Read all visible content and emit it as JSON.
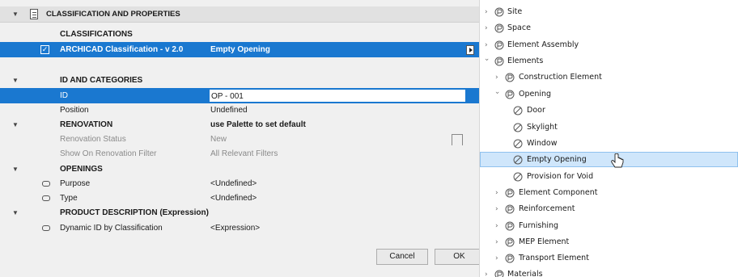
{
  "panel": {
    "title": "CLASSIFICATION AND PROPERTIES",
    "classifications_heading": "CLASSIFICATIONS",
    "classification": {
      "system": "ARCHICAD Classification - v 2.0",
      "value": "Empty Opening"
    },
    "sections": {
      "id_categories": "ID AND CATEGORIES",
      "renovation": "RENOVATION",
      "renovation_value": "use Palette to set default",
      "openings": "OPENINGS",
      "product": "PRODUCT DESCRIPTION (Expression)"
    },
    "rows": {
      "id": {
        "label": "ID",
        "value": "OP - 001"
      },
      "position": {
        "label": "Position",
        "value": "Undefined"
      },
      "renovation_status": {
        "label": "Renovation Status",
        "value": "New"
      },
      "show_filter": {
        "label": "Show On Renovation Filter",
        "value": "All Relevant Filters"
      },
      "purpose": {
        "label": "Purpose",
        "value": "<Undefined>"
      },
      "type": {
        "label": "Type",
        "value": "<Undefined>"
      },
      "dynamic_id": {
        "label": "Dynamic ID by Classification",
        "value": "<Expression>"
      }
    },
    "buttons": {
      "cancel": "Cancel",
      "ok": "OK"
    }
  },
  "tree": {
    "items": [
      {
        "label": "Site",
        "expanded": false
      },
      {
        "label": "Space",
        "expanded": false
      },
      {
        "label": "Element Assembly",
        "expanded": false
      },
      {
        "label": "Elements",
        "expanded": true
      },
      {
        "label": "Construction Element",
        "expanded": false
      },
      {
        "label": "Opening",
        "expanded": true
      },
      {
        "label": "Door"
      },
      {
        "label": "Skylight"
      },
      {
        "label": "Window"
      },
      {
        "label": "Empty Opening",
        "selected": true
      },
      {
        "label": "Provision for Void"
      },
      {
        "label": "Element Component",
        "expanded": false
      },
      {
        "label": "Reinforcement",
        "expanded": false
      },
      {
        "label": "Furnishing",
        "expanded": false
      },
      {
        "label": "MEP Element",
        "expanded": false
      },
      {
        "label": "Transport Element",
        "expanded": false
      },
      {
        "label": "Materials",
        "expanded": false
      }
    ]
  },
  "colors": {
    "selection": "#1a78d0",
    "tree_highlight": "#cfe6fb"
  }
}
